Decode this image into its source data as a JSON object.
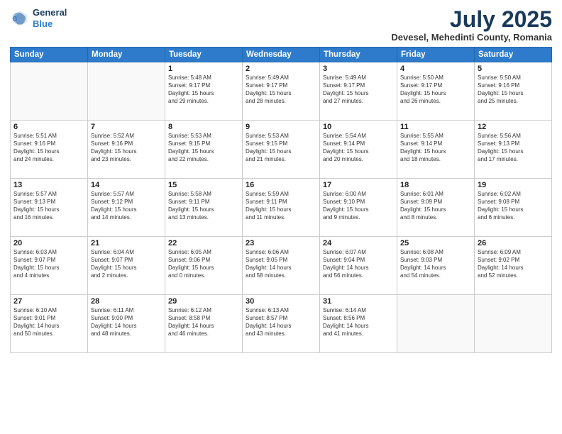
{
  "logo": {
    "line1": "General",
    "line2": "Blue"
  },
  "title": "July 2025",
  "location": "Devesel, Mehedinti County, Romania",
  "weekdays": [
    "Sunday",
    "Monday",
    "Tuesday",
    "Wednesday",
    "Thursday",
    "Friday",
    "Saturday"
  ],
  "weeks": [
    [
      {
        "day": "",
        "text": ""
      },
      {
        "day": "",
        "text": ""
      },
      {
        "day": "1",
        "text": "Sunrise: 5:48 AM\nSunset: 9:17 PM\nDaylight: 15 hours\nand 29 minutes."
      },
      {
        "day": "2",
        "text": "Sunrise: 5:49 AM\nSunset: 9:17 PM\nDaylight: 15 hours\nand 28 minutes."
      },
      {
        "day": "3",
        "text": "Sunrise: 5:49 AM\nSunset: 9:17 PM\nDaylight: 15 hours\nand 27 minutes."
      },
      {
        "day": "4",
        "text": "Sunrise: 5:50 AM\nSunset: 9:17 PM\nDaylight: 15 hours\nand 26 minutes."
      },
      {
        "day": "5",
        "text": "Sunrise: 5:50 AM\nSunset: 9:16 PM\nDaylight: 15 hours\nand 25 minutes."
      }
    ],
    [
      {
        "day": "6",
        "text": "Sunrise: 5:51 AM\nSunset: 9:16 PM\nDaylight: 15 hours\nand 24 minutes."
      },
      {
        "day": "7",
        "text": "Sunrise: 5:52 AM\nSunset: 9:16 PM\nDaylight: 15 hours\nand 23 minutes."
      },
      {
        "day": "8",
        "text": "Sunrise: 5:53 AM\nSunset: 9:15 PM\nDaylight: 15 hours\nand 22 minutes."
      },
      {
        "day": "9",
        "text": "Sunrise: 5:53 AM\nSunset: 9:15 PM\nDaylight: 15 hours\nand 21 minutes."
      },
      {
        "day": "10",
        "text": "Sunrise: 5:54 AM\nSunset: 9:14 PM\nDaylight: 15 hours\nand 20 minutes."
      },
      {
        "day": "11",
        "text": "Sunrise: 5:55 AM\nSunset: 9:14 PM\nDaylight: 15 hours\nand 18 minutes."
      },
      {
        "day": "12",
        "text": "Sunrise: 5:56 AM\nSunset: 9:13 PM\nDaylight: 15 hours\nand 17 minutes."
      }
    ],
    [
      {
        "day": "13",
        "text": "Sunrise: 5:57 AM\nSunset: 9:13 PM\nDaylight: 15 hours\nand 16 minutes."
      },
      {
        "day": "14",
        "text": "Sunrise: 5:57 AM\nSunset: 9:12 PM\nDaylight: 15 hours\nand 14 minutes."
      },
      {
        "day": "15",
        "text": "Sunrise: 5:58 AM\nSunset: 9:11 PM\nDaylight: 15 hours\nand 13 minutes."
      },
      {
        "day": "16",
        "text": "Sunrise: 5:59 AM\nSunset: 9:11 PM\nDaylight: 15 hours\nand 11 minutes."
      },
      {
        "day": "17",
        "text": "Sunrise: 6:00 AM\nSunset: 9:10 PM\nDaylight: 15 hours\nand 9 minutes."
      },
      {
        "day": "18",
        "text": "Sunrise: 6:01 AM\nSunset: 9:09 PM\nDaylight: 15 hours\nand 8 minutes."
      },
      {
        "day": "19",
        "text": "Sunrise: 6:02 AM\nSunset: 9:08 PM\nDaylight: 15 hours\nand 6 minutes."
      }
    ],
    [
      {
        "day": "20",
        "text": "Sunrise: 6:03 AM\nSunset: 9:07 PM\nDaylight: 15 hours\nand 4 minutes."
      },
      {
        "day": "21",
        "text": "Sunrise: 6:04 AM\nSunset: 9:07 PM\nDaylight: 15 hours\nand 2 minutes."
      },
      {
        "day": "22",
        "text": "Sunrise: 6:05 AM\nSunset: 9:06 PM\nDaylight: 15 hours\nand 0 minutes."
      },
      {
        "day": "23",
        "text": "Sunrise: 6:06 AM\nSunset: 9:05 PM\nDaylight: 14 hours\nand 58 minutes."
      },
      {
        "day": "24",
        "text": "Sunrise: 6:07 AM\nSunset: 9:04 PM\nDaylight: 14 hours\nand 56 minutes."
      },
      {
        "day": "25",
        "text": "Sunrise: 6:08 AM\nSunset: 9:03 PM\nDaylight: 14 hours\nand 54 minutes."
      },
      {
        "day": "26",
        "text": "Sunrise: 6:09 AM\nSunset: 9:02 PM\nDaylight: 14 hours\nand 52 minutes."
      }
    ],
    [
      {
        "day": "27",
        "text": "Sunrise: 6:10 AM\nSunset: 9:01 PM\nDaylight: 14 hours\nand 50 minutes."
      },
      {
        "day": "28",
        "text": "Sunrise: 6:11 AM\nSunset: 9:00 PM\nDaylight: 14 hours\nand 48 minutes."
      },
      {
        "day": "29",
        "text": "Sunrise: 6:12 AM\nSunset: 8:58 PM\nDaylight: 14 hours\nand 46 minutes."
      },
      {
        "day": "30",
        "text": "Sunrise: 6:13 AM\nSunset: 8:57 PM\nDaylight: 14 hours\nand 43 minutes."
      },
      {
        "day": "31",
        "text": "Sunrise: 6:14 AM\nSunset: 8:56 PM\nDaylight: 14 hours\nand 41 minutes."
      },
      {
        "day": "",
        "text": ""
      },
      {
        "day": "",
        "text": ""
      }
    ]
  ]
}
